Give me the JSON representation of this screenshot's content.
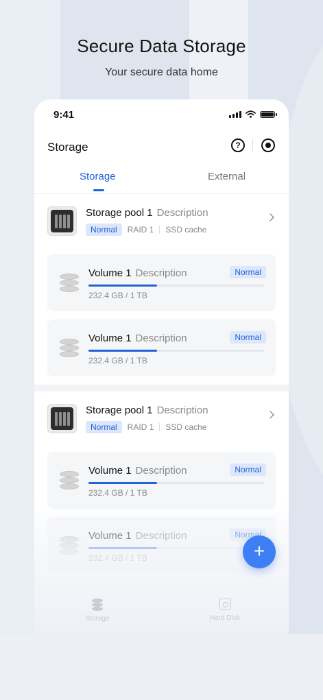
{
  "hero": {
    "title": "Secure Data Storage",
    "subtitle": "Your secure data home"
  },
  "status_bar": {
    "time": "9:41"
  },
  "header": {
    "title": "Storage"
  },
  "tabs": [
    {
      "label": "Storage",
      "active": true
    },
    {
      "label": "External",
      "active": false
    }
  ],
  "pools": [
    {
      "name": "Storage pool 1",
      "description": "Description",
      "status": "Normal",
      "raid": "RAID 1",
      "cache": "SSD cache",
      "volumes": [
        {
          "name": "Volume 1",
          "description": "Description",
          "status": "Normal",
          "usage": "232.4 GB / 1 TB",
          "fill_percent": 39
        },
        {
          "name": "Volume 1",
          "description": "Description",
          "status": "Normal",
          "usage": "232.4 GB / 1 TB",
          "fill_percent": 39
        }
      ]
    },
    {
      "name": "Storage pool 1",
      "description": "Description",
      "status": "Normal",
      "raid": "RAID 1",
      "cache": "SSD cache",
      "volumes": [
        {
          "name": "Volume 1",
          "description": "Description",
          "status": "Normal",
          "usage": "232.4 GB / 1 TB",
          "fill_percent": 39
        },
        {
          "name": "Volume 1",
          "description": "Description",
          "status": "Normal",
          "usage": "232.4 GB / 1 TB",
          "fill_percent": 39
        }
      ]
    }
  ],
  "fab": {
    "icon": "plus-icon"
  },
  "bottom_nav": [
    {
      "label": "Storage",
      "icon": "database-icon"
    },
    {
      "label": "Hard Disk",
      "icon": "hard-disk-icon"
    }
  ],
  "colors": {
    "accent": "#2262d8",
    "tag_bg": "#dde7fb",
    "fab": "#3f7ff5"
  }
}
